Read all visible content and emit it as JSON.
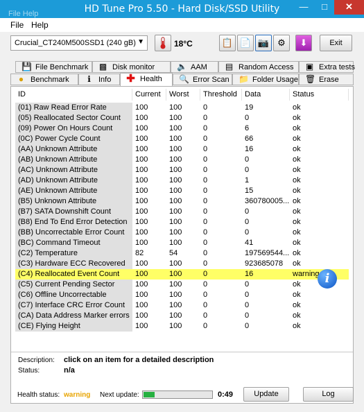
{
  "window": {
    "title": "HD Tune Pro 5.50 - Hard Disk/SSD Utility",
    "ghost_menu": "File   Help"
  },
  "menu": {
    "file": "File",
    "help": "Help"
  },
  "toolbar": {
    "drive": "Crucial_CT240M500SSD1 (240 gB)",
    "temperature": "18°C",
    "exit_label": "Exit"
  },
  "tabs": {
    "top": [
      {
        "label": "File Benchmark",
        "icon": "file-benchmark-icon"
      },
      {
        "label": "Disk monitor",
        "icon": "disk-monitor-icon"
      },
      {
        "label": "AAM",
        "icon": "speaker-icon"
      },
      {
        "label": "Random Access",
        "icon": "random-access-icon"
      },
      {
        "label": "Extra tests",
        "icon": "extra-tests-icon"
      }
    ],
    "bottom": [
      {
        "label": "Benchmark",
        "icon": "benchmark-icon"
      },
      {
        "label": "Info",
        "icon": "info-icon"
      },
      {
        "label": "Health",
        "icon": "health-cross-icon"
      },
      {
        "label": "Error Scan",
        "icon": "error-scan-icon"
      },
      {
        "label": "Folder Usage",
        "icon": "folder-icon"
      },
      {
        "label": "Erase",
        "icon": "trash-icon"
      }
    ],
    "active": "Health"
  },
  "table": {
    "headers": {
      "id": "ID",
      "current": "Current",
      "worst": "Worst",
      "threshold": "Threshold",
      "data": "Data",
      "status": "Status"
    },
    "rows": [
      {
        "id": "(01) Raw Read Error Rate",
        "current": "100",
        "worst": "100",
        "threshold": "0",
        "data": "19",
        "status": "ok"
      },
      {
        "id": "(05) Reallocated Sector Count",
        "current": "100",
        "worst": "100",
        "threshold": "0",
        "data": "0",
        "status": "ok"
      },
      {
        "id": "(09) Power On Hours Count",
        "current": "100",
        "worst": "100",
        "threshold": "0",
        "data": "6",
        "status": "ok"
      },
      {
        "id": "(0C) Power Cycle Count",
        "current": "100",
        "worst": "100",
        "threshold": "0",
        "data": "66",
        "status": "ok"
      },
      {
        "id": "(AA) Unknown Attribute",
        "current": "100",
        "worst": "100",
        "threshold": "0",
        "data": "16",
        "status": "ok"
      },
      {
        "id": "(AB) Unknown Attribute",
        "current": "100",
        "worst": "100",
        "threshold": "0",
        "data": "0",
        "status": "ok"
      },
      {
        "id": "(AC) Unknown Attribute",
        "current": "100",
        "worst": "100",
        "threshold": "0",
        "data": "0",
        "status": "ok"
      },
      {
        "id": "(AD) Unknown Attribute",
        "current": "100",
        "worst": "100",
        "threshold": "0",
        "data": "1",
        "status": "ok"
      },
      {
        "id": "(AE) Unknown Attribute",
        "current": "100",
        "worst": "100",
        "threshold": "0",
        "data": "15",
        "status": "ok"
      },
      {
        "id": "(B5) Unknown Attribute",
        "current": "100",
        "worst": "100",
        "threshold": "0",
        "data": "360780005...",
        "status": "ok"
      },
      {
        "id": "(B7) SATA Downshift Count",
        "current": "100",
        "worst": "100",
        "threshold": "0",
        "data": "0",
        "status": "ok"
      },
      {
        "id": "(B8) End To End Error Detection",
        "current": "100",
        "worst": "100",
        "threshold": "0",
        "data": "0",
        "status": "ok"
      },
      {
        "id": "(BB) Uncorrectable Error Count",
        "current": "100",
        "worst": "100",
        "threshold": "0",
        "data": "0",
        "status": "ok"
      },
      {
        "id": "(BC) Command Timeout",
        "current": "100",
        "worst": "100",
        "threshold": "0",
        "data": "41",
        "status": "ok"
      },
      {
        "id": "(C2) Temperature",
        "current": "82",
        "worst": "54",
        "threshold": "0",
        "data": "197569544...",
        "status": "ok"
      },
      {
        "id": "(C3) Hardware ECC Recovered",
        "current": "100",
        "worst": "100",
        "threshold": "0",
        "data": "923685078",
        "status": "ok"
      },
      {
        "id": "(C4) Reallocated Event Count",
        "current": "100",
        "worst": "100",
        "threshold": "0",
        "data": "16",
        "status": "warning"
      },
      {
        "id": "(C5) Current Pending Sector",
        "current": "100",
        "worst": "100",
        "threshold": "0",
        "data": "0",
        "status": "ok"
      },
      {
        "id": "(C6) Offline Uncorrectable",
        "current": "100",
        "worst": "100",
        "threshold": "0",
        "data": "0",
        "status": "ok"
      },
      {
        "id": "(C7) Interface CRC Error Count",
        "current": "100",
        "worst": "100",
        "threshold": "0",
        "data": "0",
        "status": "ok"
      },
      {
        "id": "(CA) Data Address Marker errors",
        "current": "100",
        "worst": "100",
        "threshold": "0",
        "data": "0",
        "status": "ok"
      },
      {
        "id": "(CE) Flying Height",
        "current": "100",
        "worst": "100",
        "threshold": "0",
        "data": "0",
        "status": "ok"
      }
    ]
  },
  "details": {
    "description_label": "Description:",
    "description_value": "click on an item for a detailed description",
    "status_label": "Status:",
    "status_value": "n/a"
  },
  "status_bar": {
    "health_label": "Health status:",
    "health_value": "warning",
    "next_update_label": "Next update:",
    "progress_fraction": 0.16,
    "countdown": "0:49",
    "update_label": "Update",
    "log_label": "Log"
  },
  "colors": {
    "titlebar": "#1c9bd8",
    "warning_highlight": "#ffff66",
    "health_warning_text": "#e8a400",
    "progress_fill": "#25b040"
  }
}
